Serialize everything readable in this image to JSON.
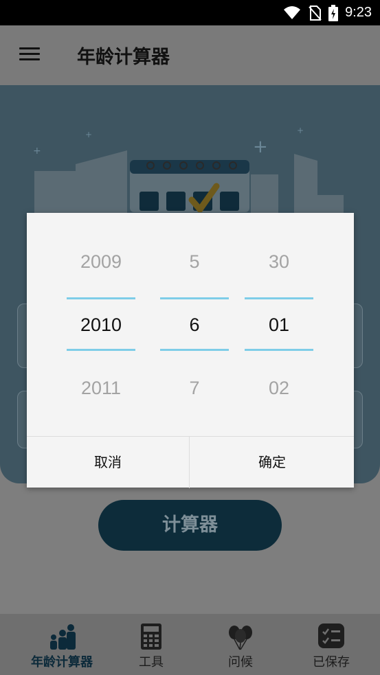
{
  "status_bar": {
    "time": "9:23",
    "icons": [
      "wifi-icon",
      "no-sim-icon",
      "battery-charging-icon"
    ]
  },
  "app_bar": {
    "title": "年龄计算器",
    "menu_icon": "hamburger-menu-icon"
  },
  "main": {
    "calculate_button": "计算器"
  },
  "date_picker": {
    "year": {
      "prev": "2009",
      "selected": "2010",
      "next": "2011"
    },
    "month": {
      "prev": "5",
      "selected": "6",
      "next": "7"
    },
    "day": {
      "prev": "30",
      "selected": "01",
      "next": "02"
    },
    "cancel_label": "取消",
    "confirm_label": "确定",
    "divider_color": "#7ecde8"
  },
  "bottom_nav": {
    "items": [
      {
        "label": "年龄计算器",
        "icon": "family-icon",
        "active": true
      },
      {
        "label": "工具",
        "icon": "calculator-icon",
        "active": false
      },
      {
        "label": "问候",
        "icon": "balloons-icon",
        "active": false
      },
      {
        "label": "已保存",
        "icon": "checklist-icon",
        "active": false
      }
    ]
  },
  "colors": {
    "accent": "#0d2c3a",
    "scrim": "#7a7a7a",
    "dialog_bg": "#f4f4f4"
  }
}
